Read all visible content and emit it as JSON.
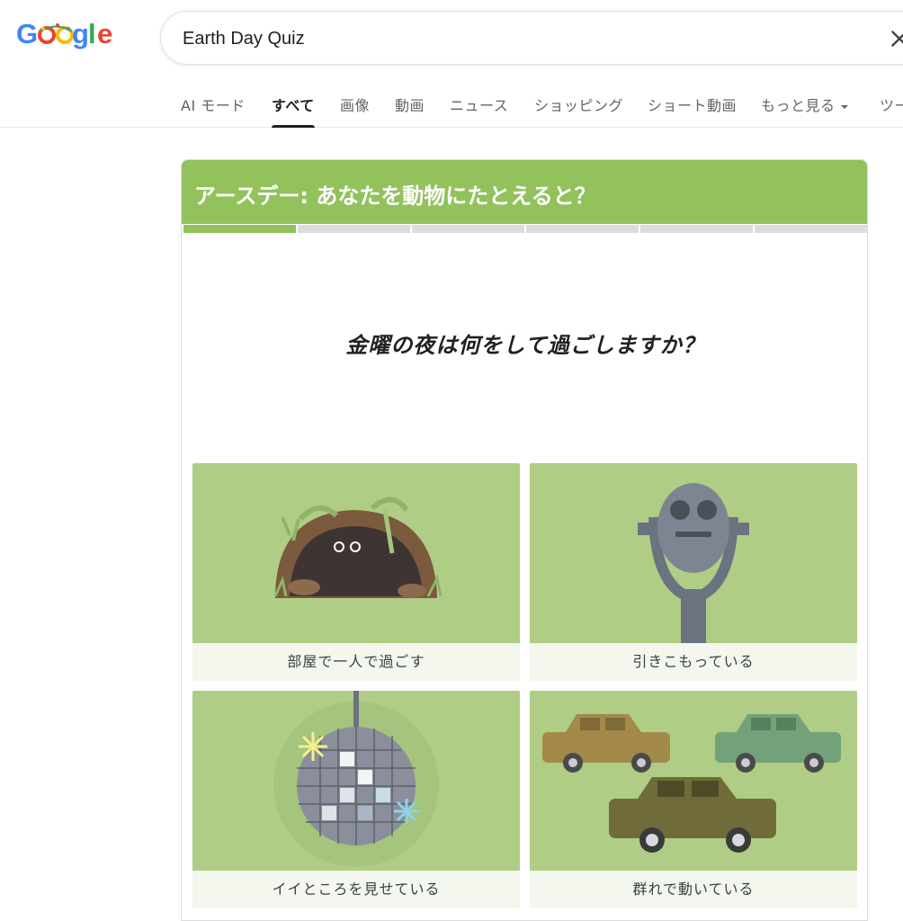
{
  "search": {
    "query": "Earth Day Quiz"
  },
  "tabs": [
    {
      "label": "AI モード"
    },
    {
      "label": "すべて"
    },
    {
      "label": "画像"
    },
    {
      "label": "動画"
    },
    {
      "label": "ニュース"
    },
    {
      "label": "ショッピング"
    },
    {
      "label": "ショート動画"
    },
    {
      "label": "もっと見る"
    },
    {
      "label": "ツー"
    }
  ],
  "quiz": {
    "title": "アースデー: あなたを動物にたとえると？",
    "progress": {
      "current": 1,
      "total": 6
    },
    "question": "金曜の夜は何をして過ごしますか？",
    "options": [
      {
        "label": "部屋で一人で過ごす",
        "icon": "cave-icon"
      },
      {
        "label": "引きこもっている",
        "icon": "binocular-viewer-icon"
      },
      {
        "label": "イイところを見せている",
        "icon": "disco-ball-icon"
      },
      {
        "label": "群れで動いている",
        "icon": "cars-icon"
      }
    ]
  },
  "colors": {
    "accent": "#93c25d",
    "card_art": "#b0cd85",
    "label_bg": "#f3f7ee"
  }
}
